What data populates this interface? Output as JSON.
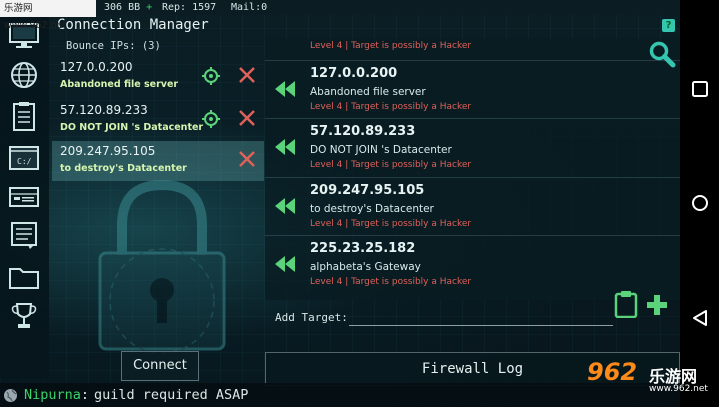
{
  "watermark": {
    "top_text": "乐游网 www.962.net",
    "bottom_number": "962",
    "bottom_cn": "乐游网",
    "bottom_url": "www.962.net"
  },
  "status": {
    "money": "306 BB",
    "money_plus": "+",
    "rep": "Rep: 1597",
    "mail": "Mail:0"
  },
  "sidebar": {
    "icons": [
      "monitor-icon",
      "globe-icon",
      "clipboard-list-icon",
      "terminal-icon",
      "server-icon",
      "document-icon",
      "folder-icon",
      "trophy-icon"
    ]
  },
  "connection_manager": {
    "title": "Connection Manager",
    "bounce_label": "Bounce IPs: (3)",
    "bounce_ips": [
      {
        "ip": "127.0.0.200",
        "name": "Abandoned file server",
        "selected": false
      },
      {
        "ip": "57.120.89.233",
        "name": "DO NOT JOIN 's Datacenter",
        "selected": false
      },
      {
        "ip": "209.247.95.105",
        "name": "to destroy's Datacenter",
        "selected": true
      }
    ],
    "connect_label": "Connect"
  },
  "hosts": {
    "first_warning": "Level 4 | Target is possibly a Hacker",
    "items": [
      {
        "ip": "127.0.0.200",
        "name": "Abandoned file server",
        "warning": "Level 4 | Target is possibly a Hacker"
      },
      {
        "ip": "57.120.89.233",
        "name": "DO NOT JOIN 's Datacenter",
        "warning": "Level 4 | Target is possibly a Hacker"
      },
      {
        "ip": "209.247.95.105",
        "name": "to destroy's Datacenter",
        "warning": "Level 4 | Target is possibly a Hacker"
      },
      {
        "ip": "225.23.25.182",
        "name": "alphabeta's Gateway",
        "warning": "Level 4 | Target is possibly a Hacker"
      }
    ]
  },
  "add_target": {
    "label": "Add Target:",
    "value": ""
  },
  "firewall_log_label": "Firewall Log",
  "chat": {
    "user": "Nipurna",
    "separator": ":",
    "message": "guild required ASAP"
  },
  "colors": {
    "accent_green": "#39d36a",
    "warning_red": "#e0605a",
    "teal": "#35c6b0"
  }
}
